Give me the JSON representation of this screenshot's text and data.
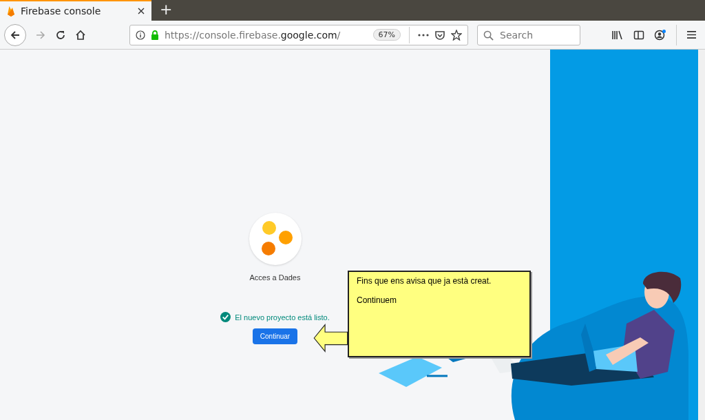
{
  "browser": {
    "tabs": [
      {
        "title": "Firebase console",
        "selected": true
      }
    ],
    "new_tab": "+",
    "url": {
      "prefix": "https://console.firebase.",
      "domain": "google.com",
      "suffix": "/"
    },
    "zoom": "67%",
    "search": {
      "placeholder": "Search"
    }
  },
  "project": {
    "name": "Acces a Dades",
    "status": "El nuevo proyecto está listo.",
    "button": "Continuar"
  },
  "callout": {
    "lines": [
      "Fins que ens avisa que ja està creat.",
      "Continuem"
    ]
  }
}
